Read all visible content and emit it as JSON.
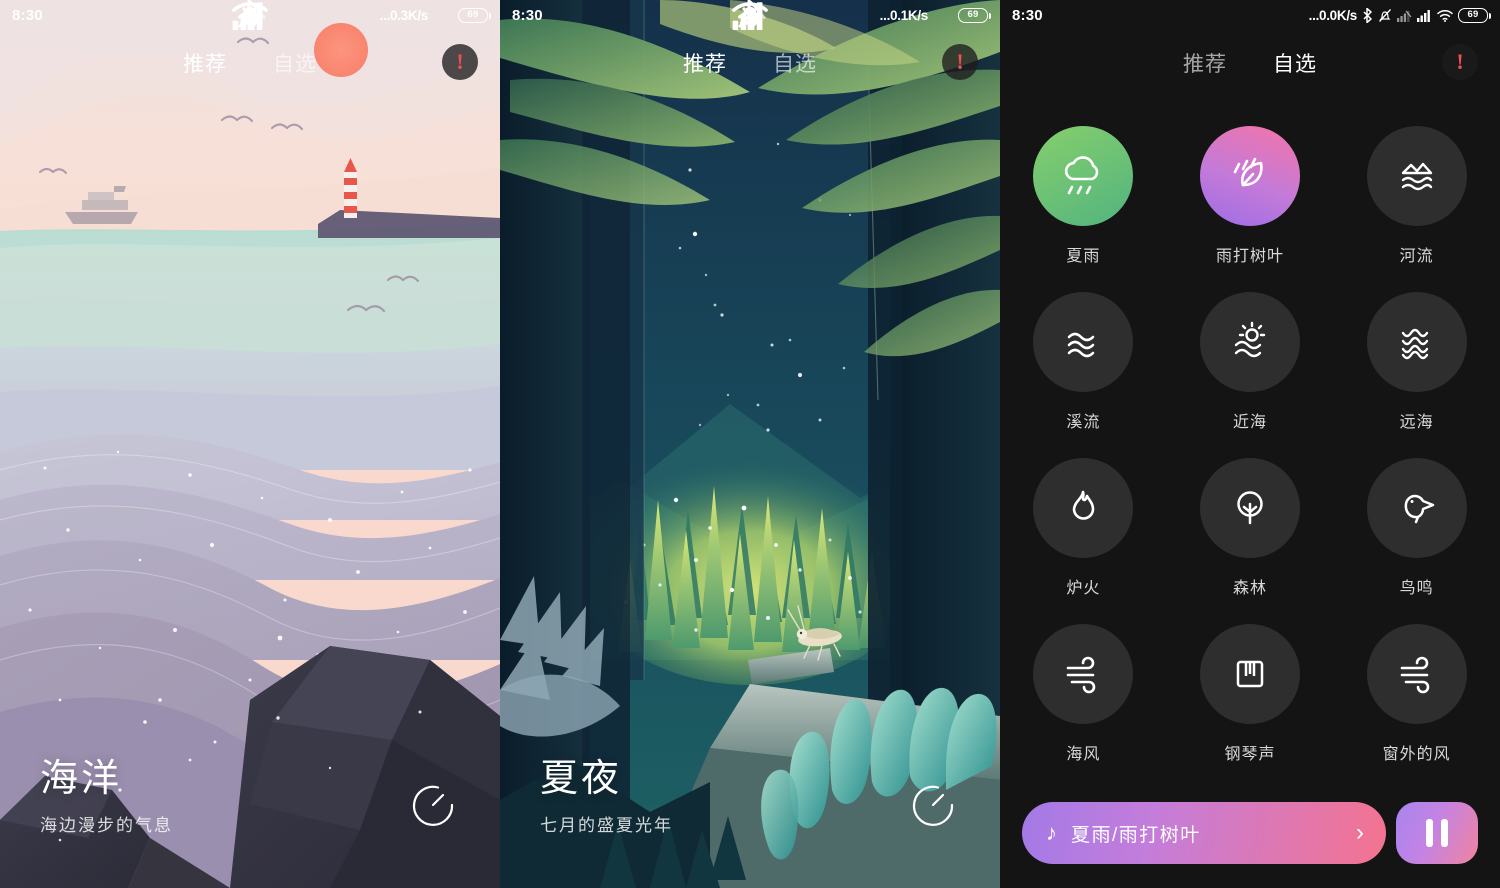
{
  "panels": [
    {
      "id": "ocean",
      "statusbar": {
        "time": "8:30",
        "speed": "...0.3K/s",
        "battery": "69"
      },
      "tabs": [
        {
          "label": "推荐",
          "active": true
        },
        {
          "label": "自选",
          "active": false
        }
      ],
      "alert_label": "!",
      "caption": {
        "title": "海洋",
        "subtitle": "海边漫步的气息"
      },
      "timer_name": "timer-icon"
    },
    {
      "id": "forest",
      "statusbar": {
        "time": "8:30",
        "speed": "...0.1K/s",
        "battery": "69"
      },
      "tabs": [
        {
          "label": "推荐",
          "active": true
        },
        {
          "label": "自选",
          "active": false
        }
      ],
      "alert_label": "!",
      "caption": {
        "title": "夏夜",
        "subtitle": "七月的盛夏光年"
      },
      "timer_name": "timer-icon"
    },
    {
      "id": "mixer",
      "statusbar": {
        "time": "8:30",
        "speed": "...0.0K/s",
        "battery": "69"
      },
      "tabs": [
        {
          "label": "推荐",
          "active": false
        },
        {
          "label": "自选",
          "active": true
        }
      ],
      "alert_label": "!"
    }
  ],
  "mixer": {
    "sounds": [
      {
        "label": "夏雨",
        "icon": "rain-cloud-icon",
        "state": "selected-green"
      },
      {
        "label": "雨打树叶",
        "icon": "rain-leaf-icon",
        "state": "selected-pink"
      },
      {
        "label": "河流",
        "icon": "river-icon",
        "state": "off"
      },
      {
        "label": "溪流",
        "icon": "stream-icon",
        "state": "off"
      },
      {
        "label": "近海",
        "icon": "coastal-sea-icon",
        "state": "off"
      },
      {
        "label": "远海",
        "icon": "open-sea-icon",
        "state": "off"
      },
      {
        "label": "炉火",
        "icon": "fire-icon",
        "state": "off"
      },
      {
        "label": "森林",
        "icon": "tree-icon",
        "state": "off"
      },
      {
        "label": "鸟鸣",
        "icon": "bird-icon",
        "state": "off"
      },
      {
        "label": "海风",
        "icon": "wind-icon",
        "state": "off"
      },
      {
        "label": "钢琴声",
        "icon": "piano-icon",
        "state": "off"
      },
      {
        "label": "窗外的风",
        "icon": "wind-icon",
        "state": "off"
      }
    ],
    "player": {
      "note_icon": "music-note-icon",
      "track": "夏雨/雨打树叶",
      "chevron": "›",
      "toggle_icon": "pause-icon"
    }
  },
  "colors": {
    "selected_green": "#86cf6c",
    "selected_pink": "#c47ad8",
    "player_gradient_start": "#a37ae6",
    "player_gradient_end": "#f4738f",
    "alert_red": "#f0504f",
    "grid_bg": "#141414",
    "bubble_off": "#2e2e2e"
  }
}
